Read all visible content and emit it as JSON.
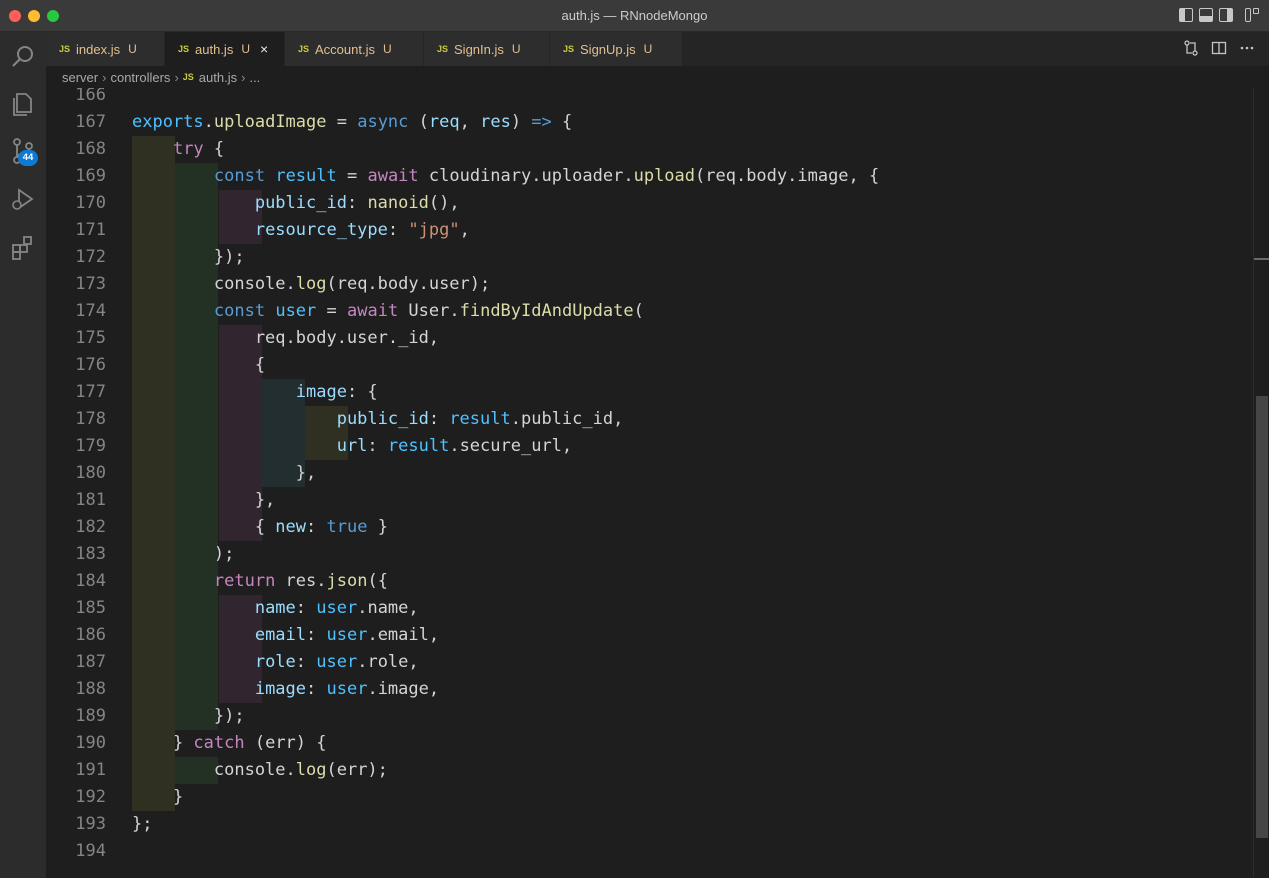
{
  "window": {
    "title": "auth.js — RNnodeMongo"
  },
  "activity": {
    "source_control_badge": "44"
  },
  "tabs": [
    {
      "label": "index.js",
      "status": "U"
    },
    {
      "label": "auth.js",
      "status": "U",
      "close": "×"
    },
    {
      "label": "Account.js",
      "status": "U"
    },
    {
      "label": "SignIn.js",
      "status": "U"
    },
    {
      "label": "SignUp.js",
      "status": "U"
    }
  ],
  "file_badge": "JS",
  "breadcrumb": {
    "parts": [
      "server",
      "controllers",
      "auth.js",
      "..."
    ]
  },
  "editor": {
    "lines": [
      {
        "num": "166",
        "tokens": []
      },
      {
        "num": "167",
        "tokens": [
          {
            "t": "exports",
            "c": "cn"
          },
          {
            "t": ".",
            "c": "pl"
          },
          {
            "t": "uploadImage",
            "c": "fn"
          },
          {
            "t": " = ",
            "c": "pl"
          },
          {
            "t": "async",
            "c": "st"
          },
          {
            "t": " (",
            "c": "pl"
          },
          {
            "t": "req",
            "c": "vr"
          },
          {
            "t": ", ",
            "c": "pl"
          },
          {
            "t": "res",
            "c": "vr"
          },
          {
            "t": ") ",
            "c": "pl"
          },
          {
            "t": "=>",
            "c": "st"
          },
          {
            "t": " {",
            "c": "pl"
          }
        ]
      },
      {
        "num": "168",
        "tokens": [
          {
            "t": "    ",
            "c": "pl"
          },
          {
            "t": "try",
            "c": "kw"
          },
          {
            "t": " {",
            "c": "pl"
          }
        ]
      },
      {
        "num": "169",
        "tokens": [
          {
            "t": "        ",
            "c": "pl"
          },
          {
            "t": "const",
            "c": "st"
          },
          {
            "t": " ",
            "c": "pl"
          },
          {
            "t": "result",
            "c": "cn"
          },
          {
            "t": " = ",
            "c": "pl"
          },
          {
            "t": "await",
            "c": "kw"
          },
          {
            "t": " cloudinary.uploader.",
            "c": "pl"
          },
          {
            "t": "upload",
            "c": "fn"
          },
          {
            "t": "(req.body.image, {",
            "c": "pl"
          }
        ]
      },
      {
        "num": "170",
        "tokens": [
          {
            "t": "            ",
            "c": "pl"
          },
          {
            "t": "public_id",
            "c": "vr"
          },
          {
            "t": ": ",
            "c": "pl"
          },
          {
            "t": "nanoid",
            "c": "fn"
          },
          {
            "t": "(),",
            "c": "pl"
          }
        ]
      },
      {
        "num": "171",
        "tokens": [
          {
            "t": "            ",
            "c": "pl"
          },
          {
            "t": "resource_type",
            "c": "vr"
          },
          {
            "t": ": ",
            "c": "pl"
          },
          {
            "t": "\"jpg\"",
            "c": "str"
          },
          {
            "t": ",",
            "c": "pl"
          }
        ]
      },
      {
        "num": "172",
        "tokens": [
          {
            "t": "        });",
            "c": "pl"
          }
        ]
      },
      {
        "num": "173",
        "tokens": [
          {
            "t": "        console.",
            "c": "pl"
          },
          {
            "t": "log",
            "c": "fn"
          },
          {
            "t": "(req.body.user);",
            "c": "pl"
          }
        ]
      },
      {
        "num": "174",
        "tokens": [
          {
            "t": "        ",
            "c": "pl"
          },
          {
            "t": "const",
            "c": "st"
          },
          {
            "t": " ",
            "c": "pl"
          },
          {
            "t": "user",
            "c": "cn"
          },
          {
            "t": " = ",
            "c": "pl"
          },
          {
            "t": "await",
            "c": "kw"
          },
          {
            "t": " User.",
            "c": "pl"
          },
          {
            "t": "findByIdAndUpdate",
            "c": "fn"
          },
          {
            "t": "(",
            "c": "pl"
          }
        ]
      },
      {
        "num": "175",
        "tokens": [
          {
            "t": "            req.body.user._id,",
            "c": "pl"
          }
        ]
      },
      {
        "num": "176",
        "tokens": [
          {
            "t": "            {",
            "c": "pl"
          }
        ]
      },
      {
        "num": "177",
        "tokens": [
          {
            "t": "                ",
            "c": "pl"
          },
          {
            "t": "image",
            "c": "vr"
          },
          {
            "t": ": {",
            "c": "pl"
          }
        ]
      },
      {
        "num": "178",
        "tokens": [
          {
            "t": "                    ",
            "c": "pl"
          },
          {
            "t": "public_id",
            "c": "vr"
          },
          {
            "t": ": ",
            "c": "pl"
          },
          {
            "t": "result",
            "c": "cn"
          },
          {
            "t": ".public_id,",
            "c": "pl"
          }
        ]
      },
      {
        "num": "179",
        "tokens": [
          {
            "t": "                    ",
            "c": "pl"
          },
          {
            "t": "url",
            "c": "vr"
          },
          {
            "t": ": ",
            "c": "pl"
          },
          {
            "t": "result",
            "c": "cn"
          },
          {
            "t": ".secure_url,",
            "c": "pl"
          }
        ]
      },
      {
        "num": "180",
        "tokens": [
          {
            "t": "                },",
            "c": "pl"
          }
        ]
      },
      {
        "num": "181",
        "tokens": [
          {
            "t": "            },",
            "c": "pl"
          }
        ]
      },
      {
        "num": "182",
        "tokens": [
          {
            "t": "            { ",
            "c": "pl"
          },
          {
            "t": "new",
            "c": "vr"
          },
          {
            "t": ": ",
            "c": "pl"
          },
          {
            "t": "true",
            "c": "st"
          },
          {
            "t": " }",
            "c": "pl"
          }
        ]
      },
      {
        "num": "183",
        "tokens": [
          {
            "t": "        );",
            "c": "pl"
          }
        ]
      },
      {
        "num": "184",
        "tokens": [
          {
            "t": "        ",
            "c": "pl"
          },
          {
            "t": "return",
            "c": "kw"
          },
          {
            "t": " res.",
            "c": "pl"
          },
          {
            "t": "json",
            "c": "fn"
          },
          {
            "t": "({",
            "c": "pl"
          }
        ]
      },
      {
        "num": "185",
        "tokens": [
          {
            "t": "            ",
            "c": "pl"
          },
          {
            "t": "name",
            "c": "vr"
          },
          {
            "t": ": ",
            "c": "pl"
          },
          {
            "t": "user",
            "c": "cn"
          },
          {
            "t": ".name,",
            "c": "pl"
          }
        ]
      },
      {
        "num": "186",
        "tokens": [
          {
            "t": "            ",
            "c": "pl"
          },
          {
            "t": "email",
            "c": "vr"
          },
          {
            "t": ": ",
            "c": "pl"
          },
          {
            "t": "user",
            "c": "cn"
          },
          {
            "t": ".email,",
            "c": "pl"
          }
        ]
      },
      {
        "num": "187",
        "tokens": [
          {
            "t": "            ",
            "c": "pl"
          },
          {
            "t": "role",
            "c": "vr"
          },
          {
            "t": ": ",
            "c": "pl"
          },
          {
            "t": "user",
            "c": "cn"
          },
          {
            "t": ".role,",
            "c": "pl"
          }
        ]
      },
      {
        "num": "188",
        "tokens": [
          {
            "t": "            ",
            "c": "pl"
          },
          {
            "t": "image",
            "c": "vr"
          },
          {
            "t": ": ",
            "c": "pl"
          },
          {
            "t": "user",
            "c": "cn"
          },
          {
            "t": ".image,",
            "c": "pl"
          }
        ]
      },
      {
        "num": "189",
        "tokens": [
          {
            "t": "        });",
            "c": "pl"
          }
        ]
      },
      {
        "num": "190",
        "tokens": [
          {
            "t": "    } ",
            "c": "pl"
          },
          {
            "t": "catch",
            "c": "kw"
          },
          {
            "t": " (err) {",
            "c": "pl"
          }
        ]
      },
      {
        "num": "191",
        "tokens": [
          {
            "t": "        console.",
            "c": "pl"
          },
          {
            "t": "log",
            "c": "fn"
          },
          {
            "t": "(err);",
            "c": "pl"
          }
        ]
      },
      {
        "num": "192",
        "tokens": [
          {
            "t": "    }",
            "c": "pl"
          }
        ]
      },
      {
        "num": "193",
        "tokens": [
          {
            "t": "};",
            "c": "pl"
          }
        ]
      },
      {
        "num": "194",
        "tokens": []
      }
    ]
  },
  "theme": {
    "indent_colors": [
      "#2f2f22",
      "#233024",
      "#312630",
      "#232e30",
      "#2f2f22"
    ]
  }
}
